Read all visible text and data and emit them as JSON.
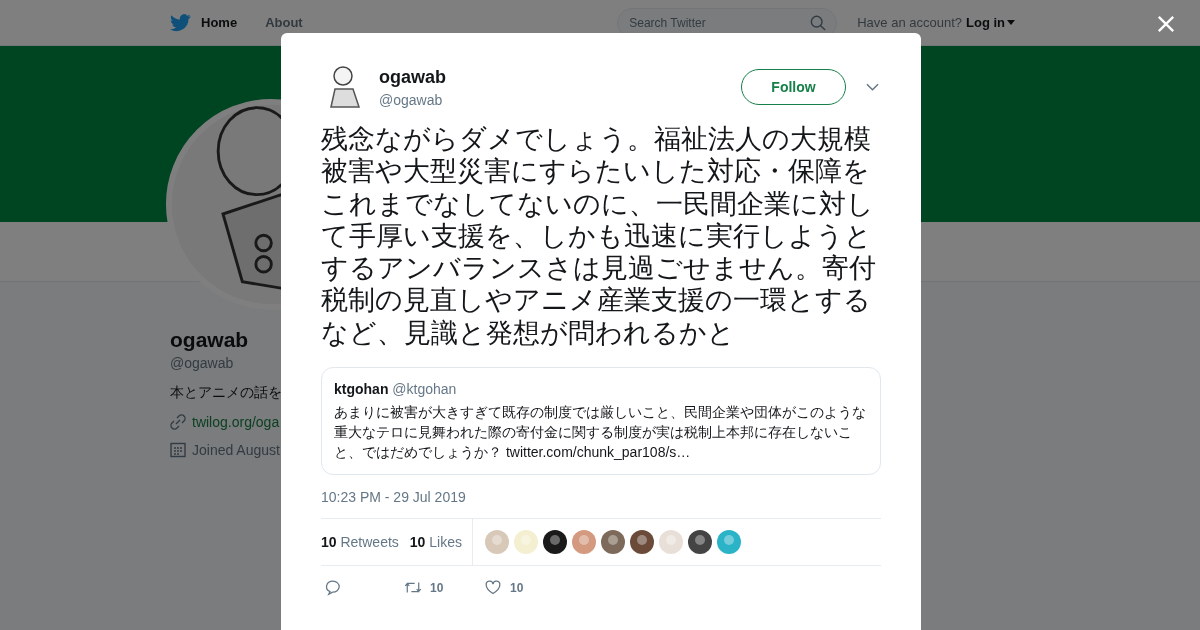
{
  "nav": {
    "items": [
      {
        "label": "Home",
        "selected": true
      },
      {
        "label": "About",
        "selected": false
      }
    ],
    "search": {
      "placeholder": "Search Twitter"
    },
    "account_prompt": "Have an account?",
    "login": "Log in"
  },
  "profile": {
    "name": "ogawab",
    "handle": "@ogawab",
    "bio": "本とアニメの話を",
    "link": "twilog.org/oga",
    "joined": "Joined August"
  },
  "tweet": {
    "name": "ogawab",
    "handle": "@ogawab",
    "follow": "Follow",
    "text": "残念ながらダメでしょう。福祉法人の大規模被害や大型災害にすらたいした対応・保障をこれまでなしてないのに、一民間企業に対して手厚い支援を、しかも迅速に実行しようとするアンバランスさは見過ごせません。寄付税制の見直しやアニメ産業支援の一環とするなど、見識と発想が問われるかと",
    "quoted": {
      "name": "ktgohan",
      "handle": "@ktgohan",
      "text": "あまりに被害が大きすぎて既存の制度では厳しいこと、民間企業や団体がこのような重大なテロに見舞われた際の寄付金に関する制度が実は税制上本邦に存在しないこと、ではだめでしょうか？",
      "link": "twitter.com/chunk_par108/s…"
    },
    "timestamp": "10:23 PM - 29 Jul 2019",
    "stats": [
      {
        "count": "10",
        "label": "Retweets"
      },
      {
        "count": "10",
        "label": "Likes"
      }
    ],
    "actions": [
      {
        "kind": "reply"
      },
      {
        "kind": "retweet",
        "count": "10"
      },
      {
        "kind": "like",
        "count": "10"
      }
    ]
  }
}
